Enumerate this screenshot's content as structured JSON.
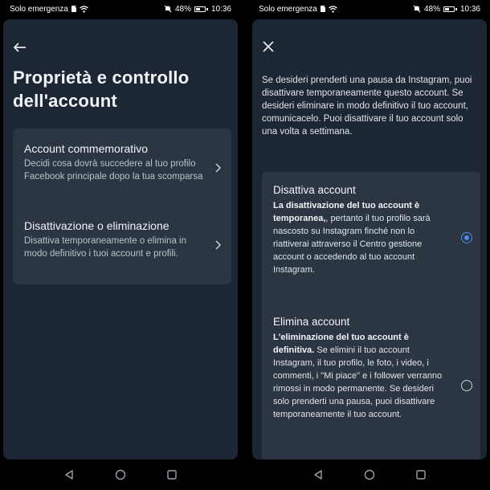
{
  "status_bar": {
    "carrier": "Solo emergenza",
    "battery": "48%",
    "time": "10:36",
    "battery_level": 0.48
  },
  "left": {
    "title": "Proprietà e controllo dell'account",
    "items": [
      {
        "title": "Account commemorativo",
        "description": "Decidi cosa dovrà succedere al tuo profilo Facebook principale dopo la tua scomparsa"
      },
      {
        "title": "Disattivazione o eliminazione",
        "description": "Disattiva temporaneamente o elimina in modo definitivo i tuoi account e profili."
      }
    ]
  },
  "right": {
    "intro": "Se desideri prenderti una pausa da Instagram, puoi disattivare temporaneamente questo account. Se desideri eliminare in modo definitivo il tuo account, comunicacelo. Puoi disattivare il tuo account solo una volta a settimana.",
    "options": [
      {
        "title": "Disattiva account",
        "bold": "La disattivazione del tuo account è temporanea,",
        "rest": ", pertanto il tuo profilo sarà nascosto su Instagram finché non lo riattiverai attraverso il Centro gestione account o accedendo al tuo account Instagram.",
        "selected": true
      },
      {
        "title": "Elimina account",
        "bold": "L'eliminazione del tuo account è definitiva.",
        "rest": " Se elimini il tuo account Instagram, il tuo profilo, le foto, i video, i commenti, i \"Mi piace\" e i follower verranno rimossi in modo permanente. Se desideri solo prenderti una pausa, puoi disattivare temporaneamente il tuo account.",
        "selected": false
      }
    ]
  },
  "icons": {
    "back": "back-arrow-icon",
    "close": "close-icon",
    "chevron": "chevron-right-icon",
    "nav_back": "triangle-back-icon",
    "nav_home": "circle-home-icon",
    "nav_recents": "square-recents-icon"
  },
  "colors": {
    "background": "#1c2733",
    "card": "#2b3642",
    "accent": "#4a8cf0"
  }
}
